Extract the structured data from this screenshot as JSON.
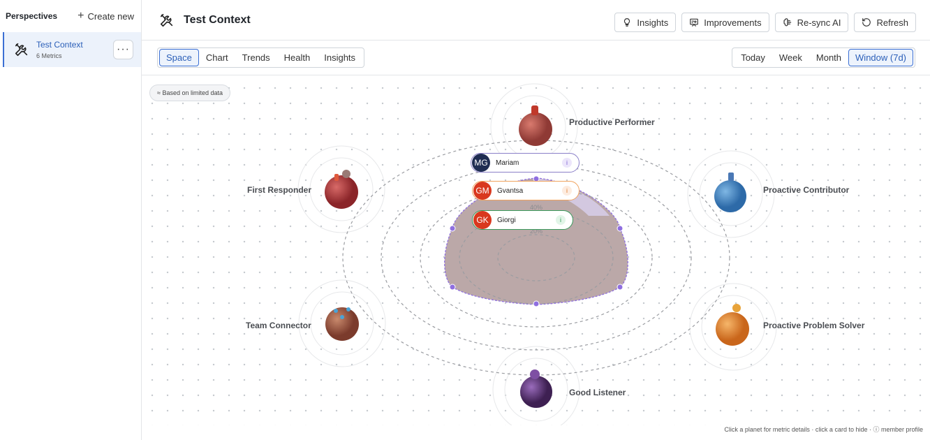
{
  "sidebar": {
    "title": "Perspectives",
    "create_label": "Create new",
    "items": [
      {
        "name": "Test Context",
        "subtitle": "6 Metrics",
        "icon": "tools-icon"
      }
    ],
    "more_label": "···"
  },
  "header": {
    "title": "Test Context",
    "icon": "tools-icon",
    "buttons": [
      {
        "label": "Insights",
        "icon": "lightbulb-icon"
      },
      {
        "label": "Improvements",
        "icon": "board-icon"
      },
      {
        "label": "Re-sync AI",
        "icon": "brain-icon"
      },
      {
        "label": "Refresh",
        "icon": "refresh-icon"
      }
    ]
  },
  "view_tabs": [
    "Space",
    "Chart",
    "Trends",
    "Health",
    "Insights"
  ],
  "active_view": "Space",
  "range_tabs": [
    "Today",
    "Week",
    "Month",
    "Window (7d)"
  ],
  "active_range": "Window (7d)",
  "canvas": {
    "badge": "≈ Based on limited data",
    "rings": {
      "r40": "40%",
      "r20": "20%"
    },
    "planets": [
      {
        "label": "Productive Performer",
        "color": "#b9524a"
      },
      {
        "label": "Proactive Contributor",
        "color": "#3f86c4"
      },
      {
        "label": "Proactive Problem Solver",
        "color": "#e58a2e"
      },
      {
        "label": "Good Listener",
        "color": "#6a3a86"
      },
      {
        "label": "Team Connector",
        "color": "#a45a45"
      },
      {
        "label": "First Responder",
        "color": "#b0383b"
      }
    ],
    "members": [
      {
        "initials": "MG",
        "name": "Mariam",
        "avatar_color": "#1f2d52",
        "border_color": "#8a7fc8",
        "info_color": "#7b5fd0",
        "info_bg": "#ece6fb"
      },
      {
        "initials": "GM",
        "name": "Gvantsa",
        "avatar_color": "#d9381e",
        "border_color": "#f0a35e",
        "info_color": "#e07a2b",
        "info_bg": "#fdece0"
      },
      {
        "initials": "GK",
        "name": "Giorgi",
        "avatar_color": "#d9381e",
        "border_color": "#3a9a5c",
        "info_color": "#2f9a55",
        "info_bg": "#e2f5e8"
      }
    ],
    "info_glyph": "i",
    "radar_color": "#8f6fe0",
    "fill_color": "#bba8a8"
  },
  "footer_hint": "Click a planet for metric details · click a card to hide · ⓘ member profile"
}
